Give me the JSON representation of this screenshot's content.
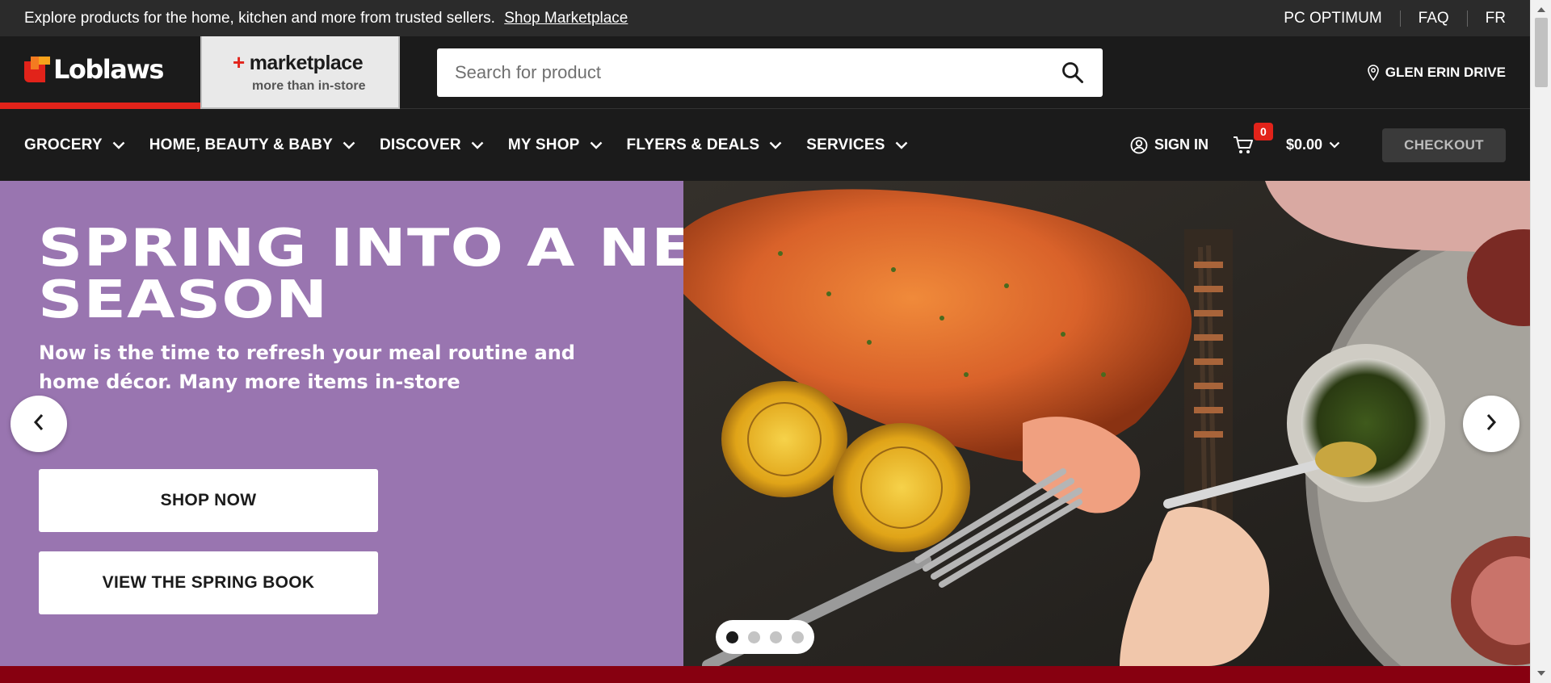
{
  "utility_bar": {
    "promo_text": "Explore products for the home, kitchen and more from trusted sellers.",
    "promo_link": "Shop Marketplace",
    "links": [
      "PC OPTIMUM",
      "FAQ",
      "FR"
    ]
  },
  "header": {
    "logo_text": "Loblaws",
    "marketplace": {
      "title": "marketplace",
      "subtitle": "more than in-store"
    },
    "search": {
      "placeholder": "Search for product",
      "value": ""
    },
    "store_location": "GLEN ERIN DRIVE"
  },
  "nav": {
    "items": [
      {
        "label": "GROCERY"
      },
      {
        "label": "HOME, BEAUTY & BABY"
      },
      {
        "label": "DISCOVER"
      },
      {
        "label": "MY SHOP"
      },
      {
        "label": "FLYERS & DEALS"
      },
      {
        "label": "SERVICES"
      }
    ],
    "sign_in": "SIGN IN",
    "cart_count": "0",
    "cart_total": "$0.00",
    "checkout": "CHECKOUT"
  },
  "hero": {
    "title": "SPRING INTO A NEW SEASON",
    "subtitle": "Now is the time to refresh your meal routine and home décor. Many more items in-store",
    "buttons": {
      "shop_now": "SHOP NOW",
      "view_book": "VIEW THE SPRING BOOK"
    },
    "slides_total": 4,
    "active_slide": 1,
    "image_description": "grilled-salmon-lemon-food-photo"
  },
  "colors": {
    "brand_red": "#e2231a",
    "hero_purple": "#9975b0",
    "header_dark": "#1b1b1b",
    "utility_dark": "#2b2b2b",
    "bottom_band": "#870010"
  }
}
